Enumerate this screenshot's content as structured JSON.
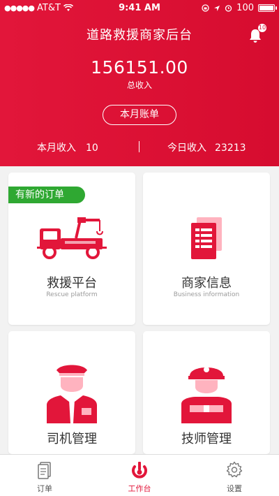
{
  "status_bar": {
    "carrier": "AT&T",
    "time": "9:41 AM",
    "battery": "100"
  },
  "header": {
    "title": "道路救援商家后台",
    "notification_count": "10",
    "total_income_value": "156151.00",
    "total_income_label": "总收入",
    "bill_button": "本月账单",
    "month_income_label": "本月收入",
    "month_income_value": "10",
    "today_income_label": "今日收入",
    "today_income_value": "23213",
    "separator": "|"
  },
  "grid": {
    "new_order_tag": "有新的订单",
    "cards": [
      {
        "title": "救援平台",
        "subtitle": "Rescue platform",
        "icon": "tow-truck-icon"
      },
      {
        "title": "商家信息",
        "subtitle": "Business information",
        "icon": "documents-icon"
      },
      {
        "title": "司机管理",
        "subtitle": "",
        "icon": "driver-icon"
      },
      {
        "title": "技师管理",
        "subtitle": "",
        "icon": "technician-icon"
      }
    ]
  },
  "tabbar": {
    "items": [
      {
        "label": "订单",
        "icon": "order-icon",
        "active": false
      },
      {
        "label": "工作台",
        "icon": "workbench-icon",
        "active": true
      },
      {
        "label": "设置",
        "icon": "gear-icon",
        "active": false
      }
    ]
  },
  "colors": {
    "brand_red": "#e2163a",
    "tag_green": "#2fa832",
    "background": "#f2f2f2"
  }
}
